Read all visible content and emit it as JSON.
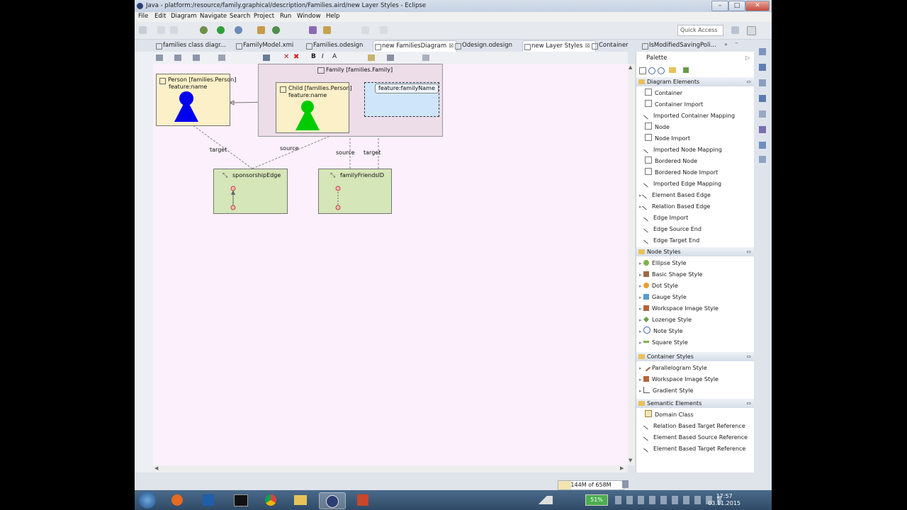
{
  "window": {
    "title": "Java - platform:/resource/family.graphical/description/Families.aird/new Layer Styles - Eclipse"
  },
  "menu": [
    "File",
    "Edit",
    "Diagram",
    "Navigate",
    "Search",
    "Project",
    "Run",
    "Window",
    "Help"
  ],
  "quick_access": "Quick Access",
  "tabs": [
    {
      "label": "families class diagr...",
      "active": false
    },
    {
      "label": "FamilyModel.xmi",
      "active": false
    },
    {
      "label": "Families.odesign",
      "active": false
    },
    {
      "label": "new FamiliesDiagram",
      "active": true
    },
    {
      "label": "Odesign.odesign",
      "active": false
    },
    {
      "label": "new Layer Styles",
      "active": true
    },
    {
      "label": "Container",
      "active": false
    },
    {
      "label": "IsModifiedSavingPoli...",
      "active": false
    }
  ],
  "diagram": {
    "family_container": "Family [families.Family]",
    "person_node": "Person [families.Person]",
    "person_feature": "feature:name",
    "child_node": "Child [families.Person]",
    "child_feature": "feature:name",
    "family_name_feature": "feature:familyName",
    "sponsorship_edge": "sponsorshipEdge",
    "family_friends_edge": "familyFriendsID",
    "label_target_1": "target",
    "label_source_1": "source",
    "label_source_2": "source",
    "label_target_2": "target"
  },
  "palette": {
    "title": "Palette",
    "sections": [
      {
        "name": "Diagram Elements",
        "items": [
          "Container",
          "Container Import",
          "Imported Container Mapping",
          "Node",
          "Node Import",
          "Imported Node Mapping",
          "Bordered Node",
          "Bordered Node Import",
          "Imported Edge Mapping",
          "Element Based Edge",
          "Relation Based Edge",
          "Edge Import",
          "Edge Source End",
          "Edge Target End"
        ]
      },
      {
        "name": "Node Styles",
        "items": [
          "Ellipse Style",
          "Basic Shape Style",
          "Dot Style",
          "Gauge Style",
          "Workspace Image Style",
          "Lozenge Style",
          "Note Style",
          "Square Style"
        ]
      },
      {
        "name": "Container Styles",
        "items": [
          "Parallelogram Style",
          "Workspace Image Style",
          "Gradient Style"
        ]
      },
      {
        "name": "Semantic Elements",
        "items": [
          "Domain Class",
          "Relation Based Target Reference",
          "Element Based Source Reference",
          "Element Based Target Reference"
        ]
      }
    ]
  },
  "status": {
    "memory": "144M of 658M"
  },
  "taskbar": {
    "battery": "51%",
    "time": "17:57",
    "date": "03.11.2015"
  },
  "colors": {
    "canvas": "#fbf0fb",
    "person_figure": "#0000ee",
    "child_figure": "#00cc00",
    "edge_node": "#d5e6b8",
    "node_bg": "#fbf0c8"
  }
}
